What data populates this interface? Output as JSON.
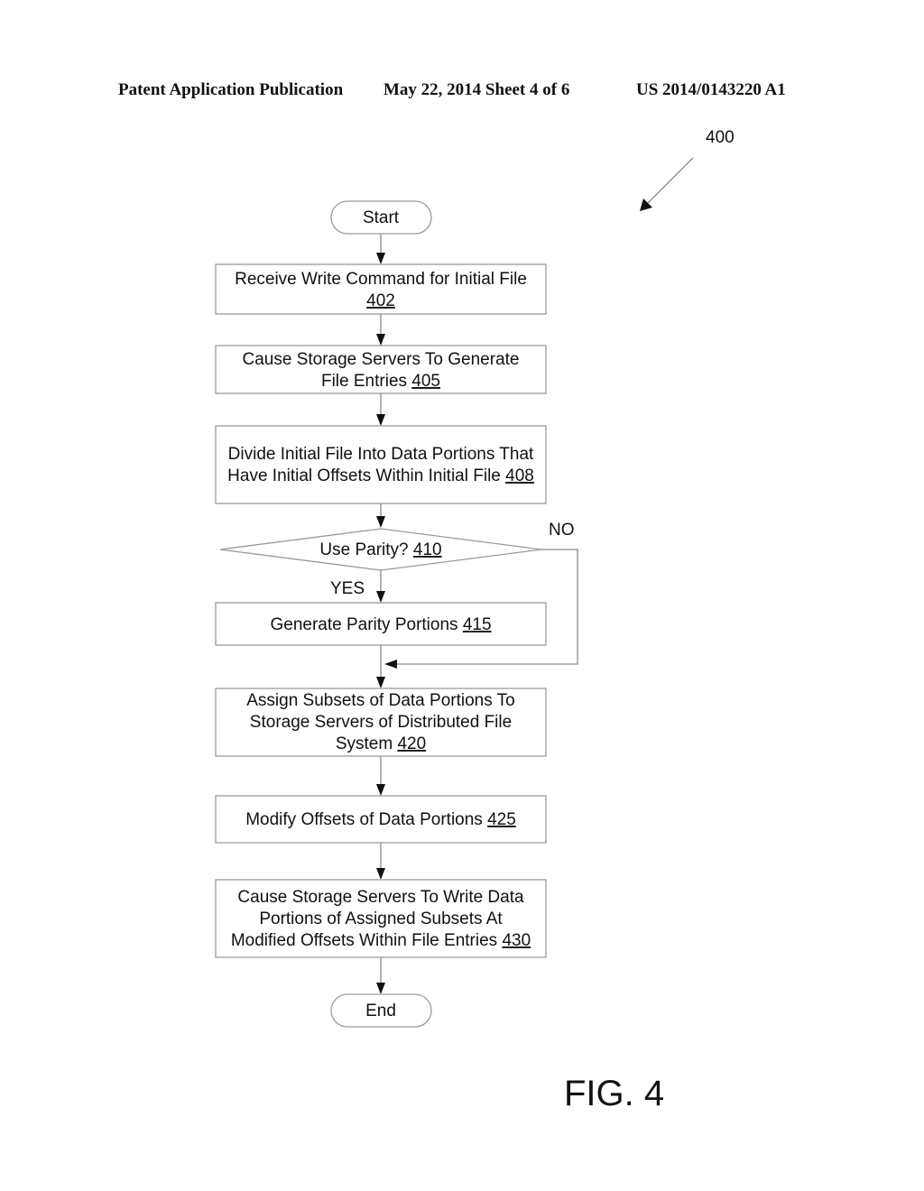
{
  "header": {
    "left": "Patent Application Publication",
    "date_sheet": "May 22, 2014  Sheet 4 of 6",
    "pub_number": "US 2014/0143220 A1"
  },
  "figure": {
    "ref_number": "400",
    "label": "FIG. 4"
  },
  "flowchart": {
    "start": "Start",
    "end": "End",
    "steps": [
      {
        "id": "402",
        "lines": [
          "Receive Write Command for Initial File"
        ],
        "ref_line": ""
      },
      {
        "id": "405",
        "lines": [
          "Cause Storage Servers To Generate"
        ],
        "ref_line": "File Entries "
      },
      {
        "id": "408",
        "lines": [
          "Divide Initial File Into Data Portions That"
        ],
        "ref_line": "Have Initial Offsets Within Initial File "
      },
      {
        "id": "415",
        "lines": [],
        "ref_line": "Generate Parity Portions "
      },
      {
        "id": "420",
        "lines": [
          "Assign Subsets of Data Portions To",
          "Storage Servers of Distributed File"
        ],
        "ref_line": "System "
      },
      {
        "id": "425",
        "lines": [],
        "ref_line": "Modify Offsets of Data Portions "
      },
      {
        "id": "430",
        "lines": [
          "Cause Storage Servers To Write Data",
          "Portions of Assigned Subsets At"
        ],
        "ref_line": "Modified Offsets Within File Entries "
      }
    ],
    "decision": {
      "id": "410",
      "text": "Use Parity? ",
      "yes_label": "YES",
      "no_label": "NO"
    }
  }
}
